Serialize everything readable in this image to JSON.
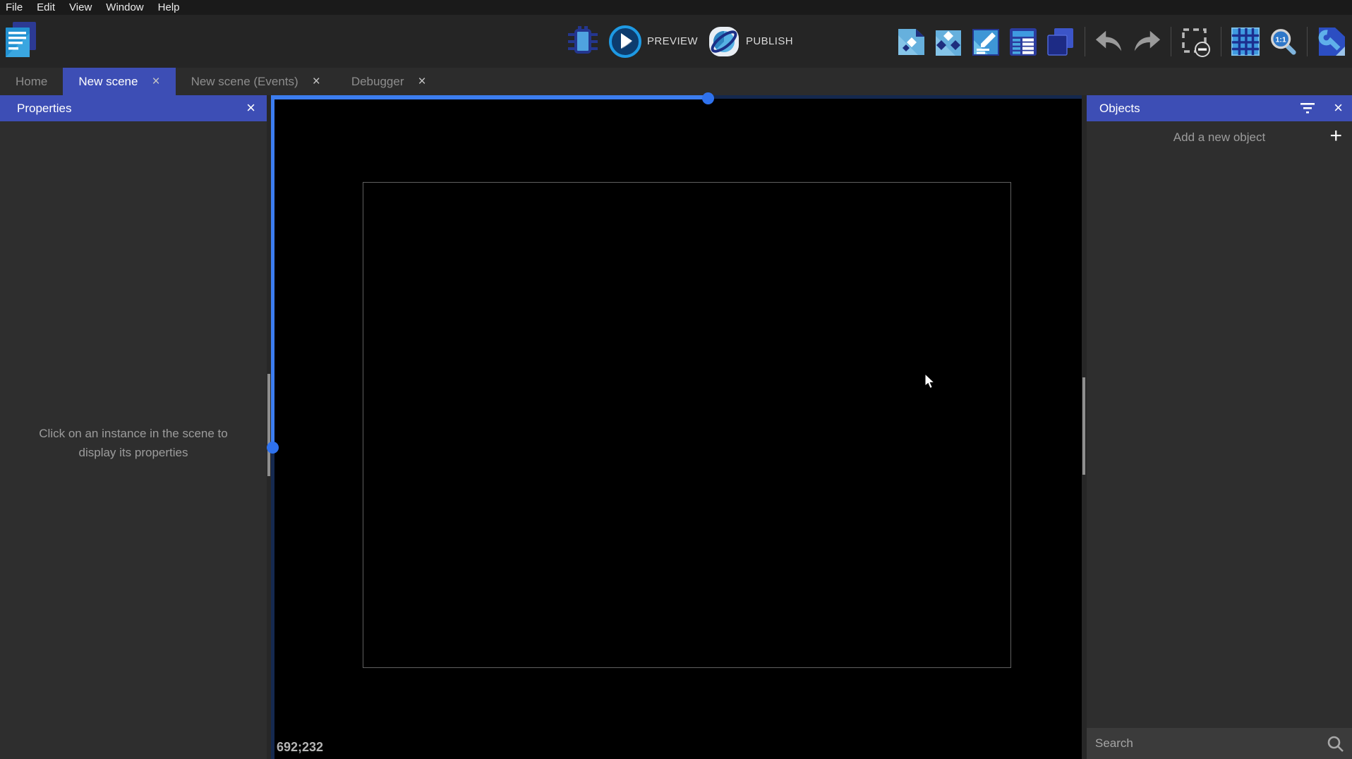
{
  "menu": {
    "items": [
      {
        "label": "File"
      },
      {
        "label": "Edit"
      },
      {
        "label": "View"
      },
      {
        "label": "Window"
      },
      {
        "label": "Help"
      }
    ]
  },
  "toolbar": {
    "preview_label": "PREVIEW",
    "publish_label": "PUBLISH",
    "left_icons": [
      "project-manager-icon"
    ],
    "center_icons": [
      "debugger-bug-icon",
      "preview-play-icon",
      "publish-globe-icon"
    ],
    "right_icons": [
      "open-objects-editor-icon",
      "open-object-groups-icon",
      "open-properties-icon",
      "open-instances-list-icon",
      "open-layers-editor-icon",
      "undo-icon",
      "redo-icon",
      "toggle-window-mask-icon",
      "toggle-grid-icon",
      "zoom-1-1-icon",
      "open-settings-icon"
    ]
  },
  "tabs": [
    {
      "label": "Home",
      "active": false,
      "closable": false
    },
    {
      "label": "New scene",
      "active": true,
      "closable": true
    },
    {
      "label": "New scene (Events)",
      "active": false,
      "closable": true
    },
    {
      "label": "Debugger",
      "active": false,
      "closable": true
    }
  ],
  "properties_panel": {
    "title": "Properties",
    "hint": "Click on an instance in the scene to display its properties"
  },
  "objects_panel": {
    "title": "Objects",
    "add_label": "Add a new object",
    "search_placeholder": "Search"
  },
  "canvas": {
    "coordinates": "692;232"
  },
  "glyphs": {
    "close": "×",
    "plus": "+"
  },
  "colors": {
    "accent_indigo": "#3d4eb5",
    "scrollbar_blue": "#3c7df0",
    "scrollbar_navy": "#15294f",
    "panel_bg": "#2e2e2e",
    "canvas_bg": "#000000"
  }
}
